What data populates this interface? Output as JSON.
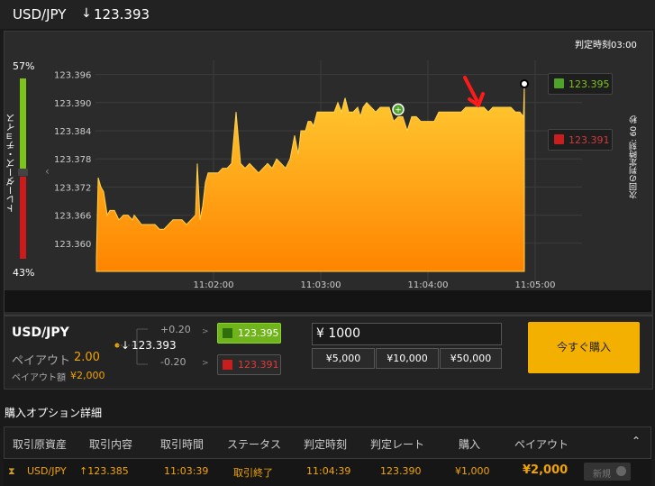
{
  "header": {
    "pair": "USD/JPY",
    "arrow": "↓",
    "rate": "123.393"
  },
  "chart": {
    "judge_time_label": "判定時刻03:00",
    "trader_choice_label": "トレーダーズ・チョイス",
    "high_pct": "57%",
    "low_pct": "43%",
    "next_judge_label": "次回の判定時刻: 60 秒",
    "high_rate": "123.395",
    "low_rate": "123.391",
    "colors": {
      "fill_top": "#ffcc33",
      "fill_bottom": "#ff8800",
      "grid": "#444444",
      "green": "#7dc41a",
      "red": "#cc1b1b",
      "up": "#4fa32a",
      "down": "#c81e1e"
    }
  },
  "chart_data": {
    "type": "area",
    "title": "",
    "xlabel": "",
    "ylabel": "",
    "y_ticks": [
      "123.396",
      "123.390",
      "123.384",
      "123.378",
      "123.372",
      "123.366",
      "123.360"
    ],
    "x_ticks": [
      "11:02:00",
      "11:03:00",
      "11:04:00",
      "11:05:00"
    ],
    "ylim": [
      123.354,
      123.399
    ],
    "x": [
      0,
      2,
      5,
      8,
      12,
      15,
      20,
      25,
      30,
      35,
      40,
      42,
      46,
      50,
      55,
      60,
      65,
      70,
      75,
      80,
      85,
      90,
      95,
      100,
      105,
      110,
      112,
      115,
      118,
      121,
      124,
      130,
      135,
      140,
      145,
      150,
      155,
      160,
      165,
      170,
      175,
      180,
      185,
      190,
      195,
      200,
      205,
      210,
      215,
      220,
      224,
      227,
      232,
      235,
      238,
      241,
      245,
      248,
      252,
      256,
      260,
      264,
      268,
      272,
      276,
      280,
      285,
      290,
      293,
      296,
      300,
      305,
      310,
      315,
      320,
      325,
      330,
      335,
      340,
      345,
      350,
      355,
      360,
      365,
      370,
      375,
      380,
      385,
      390,
      395,
      400,
      405,
      410,
      415,
      420,
      425,
      430,
      435,
      440,
      445,
      450,
      455,
      460,
      465,
      470,
      474,
      475
    ],
    "y": [
      123.357,
      123.374,
      123.372,
      123.371,
      123.366,
      123.367,
      123.367,
      123.365,
      123.366,
      123.366,
      123.365,
      123.366,
      123.365,
      123.364,
      123.364,
      123.364,
      123.364,
      123.363,
      123.363,
      123.364,
      123.365,
      123.365,
      123.365,
      123.364,
      123.365,
      123.366,
      123.377,
      123.365,
      123.368,
      123.373,
      123.375,
      123.375,
      123.375,
      123.376,
      123.376,
      123.377,
      123.388,
      123.377,
      123.376,
      123.377,
      123.376,
      123.375,
      123.376,
      123.377,
      123.376,
      123.378,
      123.377,
      123.376,
      123.378,
      123.383,
      123.379,
      123.384,
      123.384,
      123.386,
      123.386,
      123.385,
      123.388,
      123.388,
      123.388,
      123.388,
      123.388,
      123.388,
      123.39,
      123.388,
      123.391,
      123.388,
      123.388,
      123.389,
      123.387,
      123.389,
      123.39,
      123.389,
      123.388,
      123.389,
      123.389,
      123.389,
      123.386,
      123.387,
      123.387,
      123.384,
      123.387,
      123.387,
      123.386,
      123.386,
      123.386,
      123.386,
      123.388,
      123.388,
      123.388,
      123.388,
      123.388,
      123.388,
      123.389,
      123.389,
      123.389,
      123.389,
      123.389,
      123.388,
      123.389,
      123.389,
      123.389,
      123.389,
      123.389,
      123.388,
      123.388,
      123.387,
      123.394
    ],
    "buy_marker_index": 77,
    "grid": true
  },
  "trade": {
    "pair": "USD/JPY",
    "payout_label": "ペイアウト",
    "payout_value": "2.00",
    "payout_amount_label": "ペイアウト額",
    "payout_amount": "¥2,000",
    "plus": "+0.20",
    "minus": "-0.20",
    "current_arrow": "↓",
    "current": "123.393",
    "high": "123.395",
    "low": "123.391",
    "amount_value": "¥ 1000",
    "quick": [
      "¥5,000",
      "¥10,000",
      "¥50,000"
    ],
    "buy_label": "今すぐ購入"
  },
  "details": {
    "title": "購入オプション詳細",
    "columns": [
      "取引原資産",
      "取引内容",
      "取引時間",
      "ステータス",
      "判定時刻",
      "判定レート",
      "購入",
      "ペイアウト"
    ],
    "row": {
      "asset": "USD/JPY",
      "direction": "↑123.385",
      "time": "11:03:39",
      "status": "取引終了",
      "judge_time": "11:04:39",
      "judge_rate": "123.390",
      "purchase": "¥1,000",
      "payout": "¥2,000",
      "new_label": "新規"
    }
  }
}
